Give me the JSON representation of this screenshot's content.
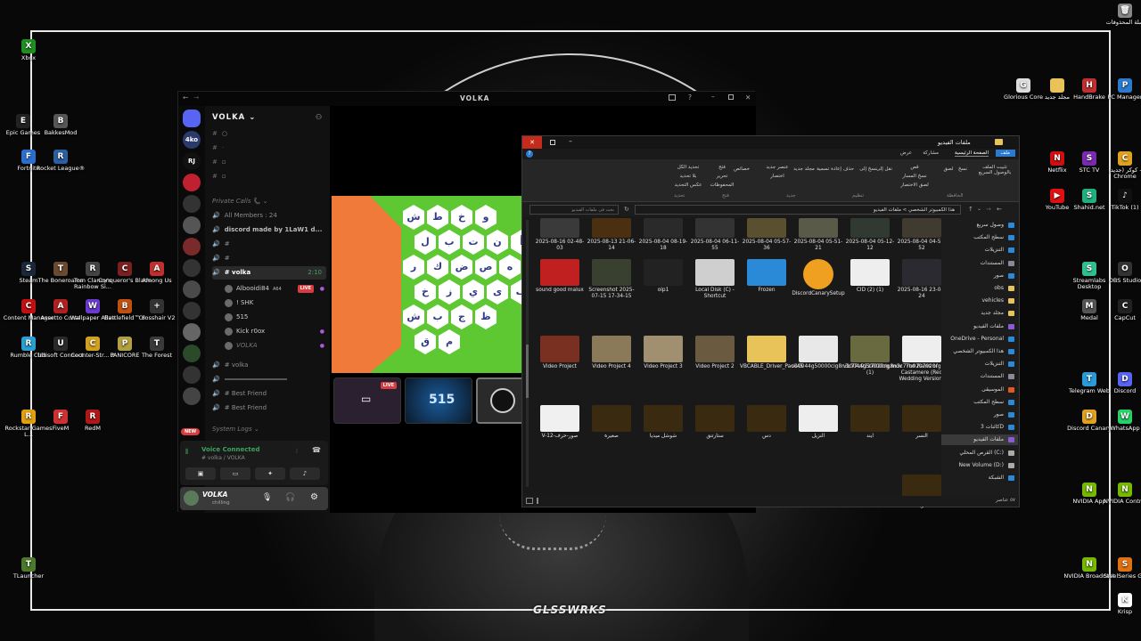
{
  "desktop": {
    "left_icons": [
      {
        "label": "Xbox",
        "color": "#1f8f1f",
        "glyph": "X"
      },
      {
        "label": "Epic Games",
        "color": "#222",
        "glyph": "E"
      },
      {
        "label": "BakkesMod",
        "color": "#555",
        "glyph": "B"
      },
      {
        "label": "Fortnite",
        "color": "#2a6fd0",
        "glyph": "F"
      },
      {
        "label": "Rocket League®",
        "color": "#2a60a0",
        "glyph": "R"
      },
      {
        "label": "Steam",
        "color": "#1b2838",
        "glyph": "S"
      },
      {
        "label": "The Boneroams",
        "color": "#6a4a30",
        "glyph": "T"
      },
      {
        "label": "Tom Clancy's Rainbow Si...",
        "color": "#444",
        "glyph": "R"
      },
      {
        "label": "Conqueror's Blade",
        "color": "#7a2020",
        "glyph": "C"
      },
      {
        "label": "Among Us",
        "color": "#c03030",
        "glyph": "A"
      },
      {
        "label": "Content Manager",
        "color": "#c01010",
        "glyph": "C"
      },
      {
        "label": "Assetto Corsa",
        "color": "#b02020",
        "glyph": "A"
      },
      {
        "label": "Wallpaper Alive",
        "color": "#6a3ad0",
        "glyph": "W"
      },
      {
        "label": "Battlefield™ 6",
        "color": "#c05010",
        "glyph": "B"
      },
      {
        "label": "Crosshair V2",
        "color": "#333",
        "glyph": "+"
      },
      {
        "label": "Rumble Club",
        "color": "#2aa0d0",
        "glyph": "R"
      },
      {
        "label": "Ubisoft Connect",
        "color": "#2a2a2a",
        "glyph": "U"
      },
      {
        "label": "Counter-Str... 2",
        "color": "#d0a020",
        "glyph": "C"
      },
      {
        "label": "PANICORE",
        "color": "#b0a040",
        "glyph": "P"
      },
      {
        "label": "The Forest",
        "color": "#3a3a3a",
        "glyph": "T"
      },
      {
        "label": "Rockstar Games L...",
        "color": "#e0a010",
        "glyph": "R"
      },
      {
        "label": "FiveM",
        "color": "#d03030",
        "glyph": "F"
      },
      {
        "label": "RedM",
        "color": "#b01818",
        "glyph": "R"
      },
      {
        "label": "TLauncher",
        "color": "#4a7a2a",
        "glyph": "T"
      }
    ],
    "right_icons": [
      {
        "label": "سلة المحذوفات",
        "color": "#888",
        "glyph": "🗑"
      },
      {
        "label": "Glorious Core",
        "color": "#ddd",
        "glyph": "G"
      },
      {
        "label": "مجلد جديد",
        "color": "#e8c35a",
        "glyph": ""
      },
      {
        "label": "HandBrake",
        "color": "#c03030",
        "glyph": "H"
      },
      {
        "label": "PC Manager",
        "color": "#2a7ad0",
        "glyph": "P"
      },
      {
        "label": "Netflix",
        "color": "#d01010",
        "glyph": "N"
      },
      {
        "label": "STC TV",
        "color": "#7a2ab0",
        "glyph": "S"
      },
      {
        "label": "کوکر (جدید) - Chrome",
        "color": "#e0a020",
        "glyph": "C"
      },
      {
        "label": "YouTube",
        "color": "#e01010",
        "glyph": "▶"
      },
      {
        "label": "Shahid.net",
        "color": "#20b080",
        "glyph": "S"
      },
      {
        "label": "TikTok (1)",
        "color": "#111",
        "glyph": "♪"
      },
      {
        "label": "Streamlabs Desktop",
        "color": "#30c090",
        "glyph": "S"
      },
      {
        "label": "OBS Studio",
        "color": "#333",
        "glyph": "O"
      },
      {
        "label": "Medal",
        "color": "#555",
        "glyph": "M"
      },
      {
        "label": "CapCut",
        "color": "#222",
        "glyph": "C"
      },
      {
        "label": "Telegram Web",
        "color": "#2a9ad8",
        "glyph": "T"
      },
      {
        "label": "Discord",
        "color": "#5865f2",
        "glyph": "D"
      },
      {
        "label": "Discord Canary",
        "color": "#e0a020",
        "glyph": "D"
      },
      {
        "label": "WhatsApp",
        "color": "#25d366",
        "glyph": "W"
      },
      {
        "label": "NVIDIA App",
        "color": "#76b900",
        "glyph": "N"
      },
      {
        "label": "NVIDIA Contr...",
        "color": "#76b900",
        "glyph": "N"
      },
      {
        "label": "NVIDIA Broadcast",
        "color": "#76b900",
        "glyph": "N"
      },
      {
        "label": "SteelSeries GG",
        "color": "#e07010",
        "glyph": "S"
      },
      {
        "label": "Krisp",
        "color": "#fff",
        "glyph": "K"
      }
    ],
    "watermark": "GLSSWRKS"
  },
  "discord": {
    "title": "VOLKA",
    "server_name": "VOLKA",
    "servers": [
      "",
      "4ko",
      "RJ",
      "",
      "",
      "",
      "",
      "",
      "",
      "",
      "",
      "",
      "",
      ""
    ],
    "private_calls": "Private Calls",
    "all_members": "All Members : 24",
    "discord_made": "discord made by 1LaW1 d...",
    "voice_channel": "volka",
    "voice_time": "2:10",
    "users": [
      "Albooidi84",
      "! SHK",
      "515",
      "Kick r0ox",
      "VOLKA"
    ],
    "user_badge": "A64",
    "live": "LIVE",
    "channel2": "volka",
    "best_friend_1": "Best Friend",
    "best_friend_2": "Best Friend",
    "system_logs": "System Logs",
    "new_badge": "NEW",
    "voice_connected": "Voice Connected",
    "voice_sub": "# volka / VOLKA",
    "me_name": "VOLKA",
    "me_status": "chilling",
    "thumb_live": "LIVE",
    "thumb_text": "515",
    "letters": [
      "ش",
      "ط",
      "خ",
      "و",
      "ل",
      "ب",
      "ت",
      "ن",
      "أ",
      "ر",
      "ك",
      "ض",
      "ص",
      "ه",
      "خ",
      "ز",
      "ي",
      "ى",
      "ف",
      "ش",
      "ب",
      "ج",
      "ظ",
      "ق",
      "م"
    ]
  },
  "explorer": {
    "title": "ملفات الفيديو",
    "tabs": [
      "ملف",
      "الصفحة الرئيسية",
      "مشاركة",
      "عرض"
    ],
    "ribbon": [
      "تثبيت الملف بالوصول السريع",
      "نسخ",
      "لصق",
      "قص",
      "نسخ المسار",
      "لصق الاختصار",
      "نقل إلى",
      "نسخ إلى",
      "حذف",
      "إعادة تسمية",
      "مجلد جديد",
      "عنصر جديد",
      "اختصار",
      "خصائص",
      "فتح",
      "تحرير",
      "المحفوظات",
      "تحديد الكل",
      "بلا تحديد",
      "عكس التحديد"
    ],
    "groups": [
      "الحافظة",
      "تنظيم",
      "جديد",
      "فتح",
      "تحديد"
    ],
    "path": "هذا الكمبيوتر الشخصي > ملفات الفيديو",
    "search": "بحث في ملفات الفيديو",
    "files": [
      {
        "name": "2025-08-16 02-48-03",
        "color": "#3a3a3a"
      },
      {
        "name": "2025-08-13 21-06-14",
        "color": "#4a3010"
      },
      {
        "name": "2025-08-04 08-19-18",
        "color": "#2a2a2a"
      },
      {
        "name": "2025-08-04 06-11-55",
        "color": "#333"
      },
      {
        "name": "2025-08-04 05-57-36",
        "color": "#5a5030"
      },
      {
        "name": "2025-08-04 05-51-21",
        "color": "#5a5a48"
      },
      {
        "name": "2025-08-04 05-12-12",
        "color": "#303a30"
      },
      {
        "name": "2025-08-04 04-55-52",
        "color": "#403a30"
      },
      {
        "name": "sound good malux",
        "color": "#c02020"
      },
      {
        "name": "Screenshot 2025-07-15 17-34-15",
        "color": "#3a4030"
      },
      {
        "name": "oip1",
        "color": "#222"
      },
      {
        "name": "Local Disk (C) - Shortcut",
        "color": "#cfcfcf"
      },
      {
        "name": "Frozen",
        "color": "#2a8ad8"
      },
      {
        "name": "DiscordCanarySetup",
        "color": "#f0a020"
      },
      {
        "name": "CID (2) (1)",
        "color": "#eee"
      },
      {
        "name": "2025-08-16 23-04-24",
        "color": "#2a2a30"
      },
      {
        "name": "Video Project",
        "color": "#7a3020"
      },
      {
        "name": "Video Project 4",
        "color": "#8a7a5a"
      },
      {
        "name": "Video Project 3",
        "color": "#a09070"
      },
      {
        "name": "Video Project 2",
        "color": "#6a5a40"
      },
      {
        "name": "VBCABLE_Driver_Pack45",
        "color": "#e8c35a"
      },
      {
        "name": "v10044g50000cig8n3c77u9217020rg.mov",
        "color": "#e8e8e8"
      },
      {
        "name": "v10044g50000cig8n3c77u9217020rg (1)",
        "color": "#6a6a40"
      },
      {
        "name": "The Rains of Castamere (Red Wedding Version)",
        "color": "#eee"
      },
      {
        "name": "V-12-صور-حرف",
        "color": "#f0f0f0"
      },
      {
        "name": "صغيرة",
        "color": "#3a2a10"
      },
      {
        "name": "شوشل ميديا",
        "color": "#3a2a10"
      },
      {
        "name": "ستارتنق",
        "color": "#3a2a10"
      },
      {
        "name": "دس",
        "color": "#3a2a10"
      },
      {
        "name": "النزيل",
        "color": "#eee"
      },
      {
        "name": "ايند",
        "color": "#3a2a10"
      },
      {
        "name": "النسر",
        "color": "#3a2a10"
      },
      {
        "name": "طوبله",
        "color": "#3a2a10"
      }
    ],
    "nav": [
      {
        "label": "وصول سريع",
        "color": "#2a8ad8"
      },
      {
        "label": "سطح المكتب",
        "color": "#2a8ad8"
      },
      {
        "label": "التنزيلات",
        "color": "#2a8ad8"
      },
      {
        "label": "المستندات",
        "color": "#8a8a9a"
      },
      {
        "label": "صور",
        "color": "#2a8ad8"
      },
      {
        "label": "obs",
        "color": "#e8c35a"
      },
      {
        "label": "vehicles",
        "color": "#e8c35a"
      },
      {
        "label": "مجلد جديد",
        "color": "#e8c35a"
      },
      {
        "label": "ملفات الفيديو",
        "color": "#8a5ad8"
      },
      {
        "label": "OneDrive - Personal",
        "color": "#2a8ad8"
      },
      {
        "label": "هذا الكمبيوتر الشخصي",
        "color": "#2a8ad8"
      },
      {
        "label": "التنزيلات",
        "color": "#2a8ad8"
      },
      {
        "label": "المستندات",
        "color": "#8a8a9a"
      },
      {
        "label": "الموسيقى",
        "color": "#e05a20"
      },
      {
        "label": "سطح المكتب",
        "color": "#2a8ad8"
      },
      {
        "label": "صور",
        "color": "#2a8ad8"
      },
      {
        "label": "كائنات 3D",
        "color": "#2a8ad8"
      },
      {
        "label": "ملفات الفيديو",
        "color": "#8a5ad8"
      },
      {
        "label": "القرص المحلي (C:)",
        "color": "#aaa"
      },
      {
        "label": "New Volume (D:)",
        "color": "#aaa"
      },
      {
        "label": "الشبكة",
        "color": "#2a8ad8"
      }
    ],
    "status": "٥٧ عناصر"
  }
}
